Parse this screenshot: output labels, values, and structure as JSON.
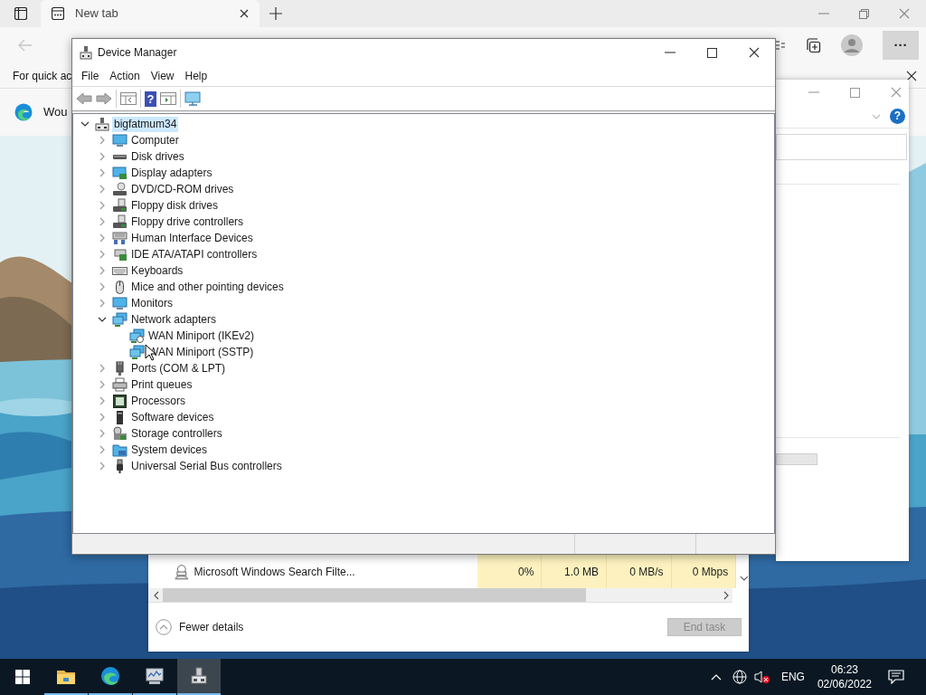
{
  "browser": {
    "tab": {
      "title": "New tab",
      "selected": true
    },
    "more_button": "···",
    "favorites_bar_text": "For quick ac",
    "banner_text": "Wou"
  },
  "device_manager": {
    "title": "Device Manager",
    "menu": [
      "File",
      "Action",
      "View",
      "Help"
    ],
    "toolbar_help": "?",
    "tree": {
      "label": "bigfatmum34",
      "expanded": true,
      "selected": true,
      "children": [
        {
          "label": "Computer",
          "expanded": false,
          "selected": false
        },
        {
          "label": "Disk drives",
          "expanded": false,
          "selected": false
        },
        {
          "label": "Display adapters",
          "expanded": false,
          "selected": false
        },
        {
          "label": "DVD/CD-ROM drives",
          "expanded": false,
          "selected": false
        },
        {
          "label": "Floppy disk drives",
          "expanded": false,
          "selected": false
        },
        {
          "label": "Floppy drive controllers",
          "expanded": false,
          "selected": false
        },
        {
          "label": "Human Interface Devices",
          "expanded": false,
          "selected": false
        },
        {
          "label": "IDE ATA/ATAPI controllers",
          "expanded": false,
          "selected": false
        },
        {
          "label": "Keyboards",
          "expanded": false,
          "selected": false
        },
        {
          "label": "Mice and other pointing devices",
          "expanded": false,
          "selected": false
        },
        {
          "label": "Monitors",
          "expanded": false,
          "selected": false
        },
        {
          "label": "Network adapters",
          "expanded": true,
          "selected": false,
          "children": [
            {
              "label": "WAN Miniport (IKEv2)",
              "selected": false
            },
            {
              "label": "WAN Miniport (SSTP)",
              "selected": false
            }
          ]
        },
        {
          "label": "Ports (COM & LPT)",
          "expanded": false,
          "selected": false
        },
        {
          "label": "Print queues",
          "expanded": false,
          "selected": false
        },
        {
          "label": "Processors",
          "expanded": false,
          "selected": false
        },
        {
          "label": "Software devices",
          "expanded": false,
          "selected": false
        },
        {
          "label": "Storage controllers",
          "expanded": false,
          "selected": false
        },
        {
          "label": "System devices",
          "expanded": false,
          "selected": false
        },
        {
          "label": "Universal Serial Bus controllers",
          "expanded": false,
          "selected": false
        }
      ]
    }
  },
  "side_window": {
    "help": "?"
  },
  "task_manager": {
    "process": {
      "name": "Microsoft Windows Search Filte...",
      "cells": [
        "0%",
        "1.0 MB",
        "0 MB/s",
        "0 Mbps"
      ]
    },
    "fewer_details": "Fewer details",
    "end_task": {
      "label": "End task",
      "disabled": true
    }
  },
  "taskbar": {
    "apps": [
      {
        "selected": false
      },
      {
        "selected": false
      },
      {
        "selected": false
      },
      {
        "selected": true
      }
    ],
    "language": "ENG",
    "time": "06:23",
    "date": "02/06/2022"
  }
}
